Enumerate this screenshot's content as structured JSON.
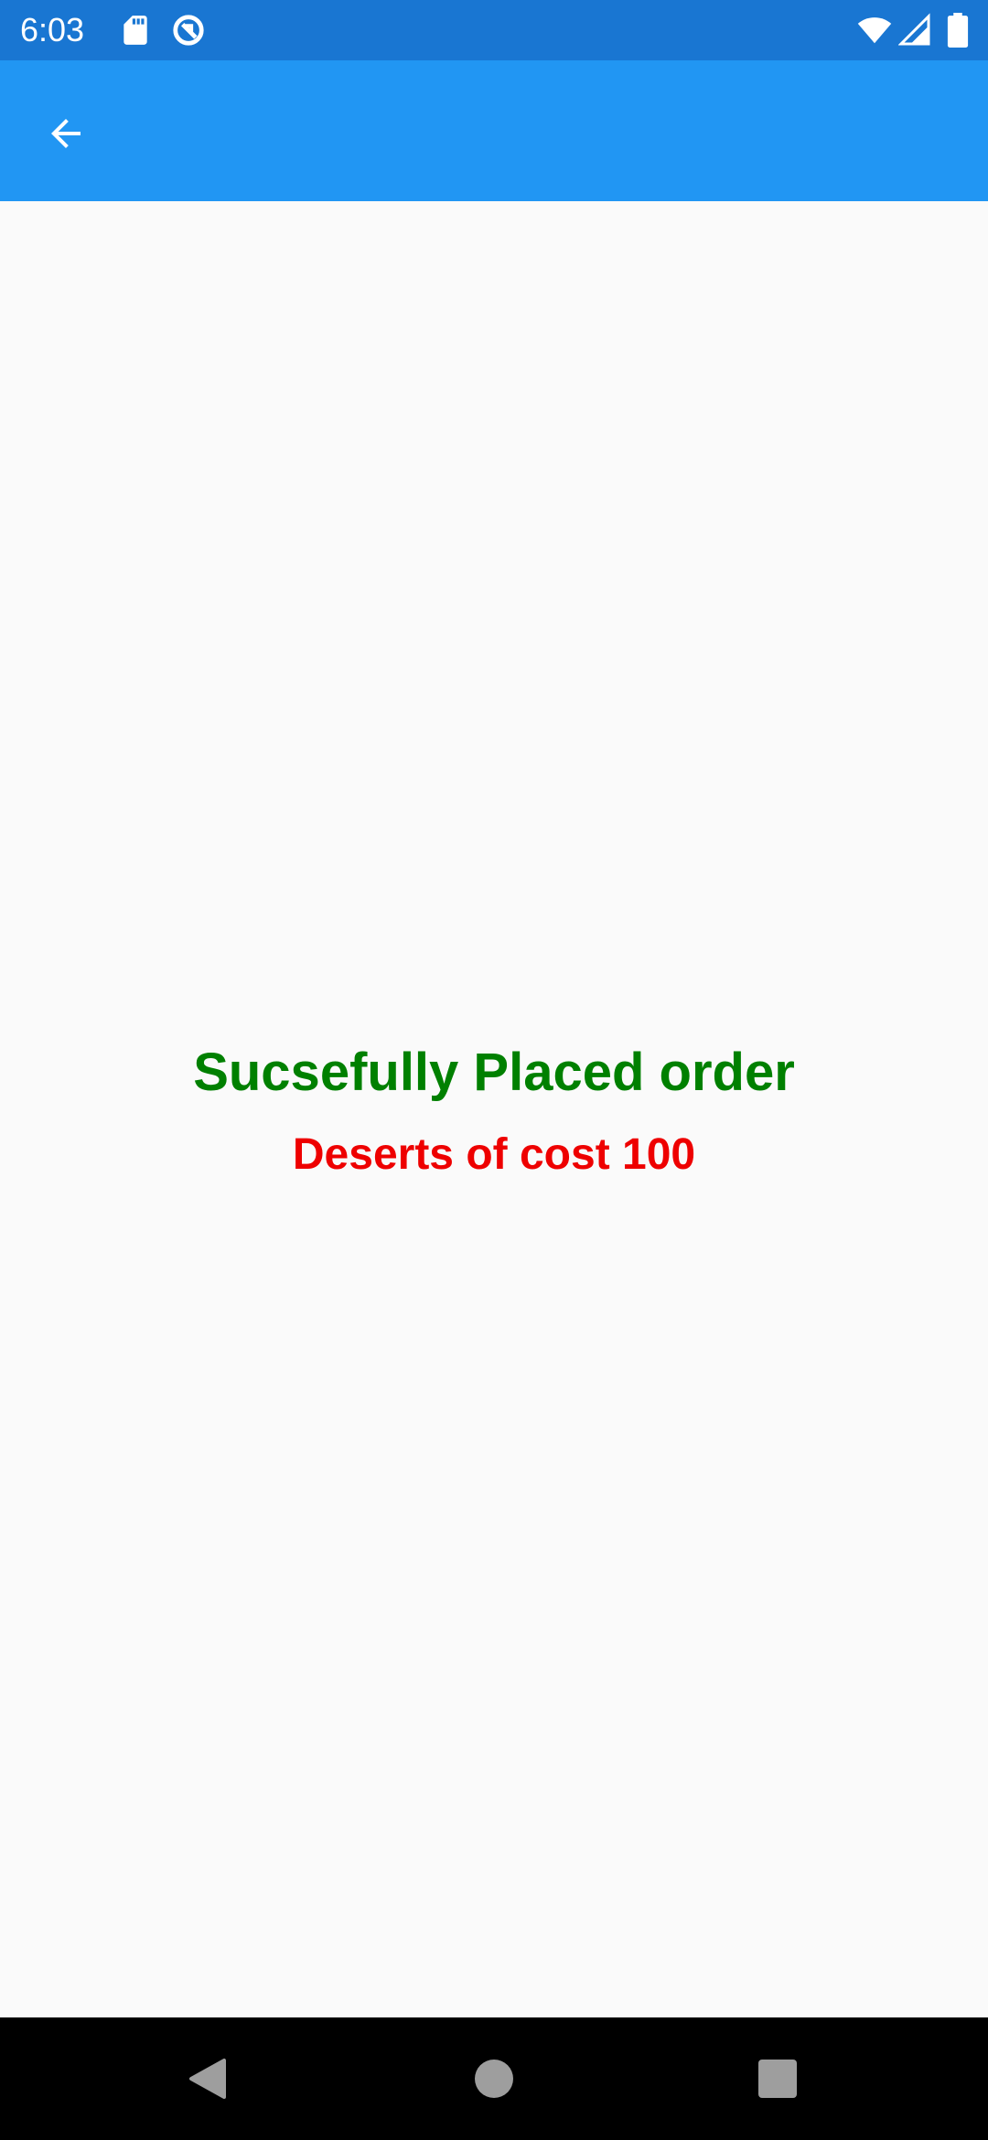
{
  "status_bar": {
    "time": "6:03",
    "icons": [
      "sd-card-icon",
      "sync-icon",
      "wifi-icon",
      "cell-signal-icon",
      "battery-icon"
    ],
    "color": "#1976d2"
  },
  "app_bar": {
    "color": "#2196f3",
    "back_icon": "arrow-back-icon"
  },
  "content": {
    "title": "Sucsefully Placed order",
    "title_color": "#008000",
    "detail": "Deserts of cost 100",
    "detail_color": "#ee0000"
  },
  "nav_bar": {
    "buttons": [
      "nav-back-icon",
      "nav-home-icon",
      "nav-recents-icon"
    ]
  }
}
